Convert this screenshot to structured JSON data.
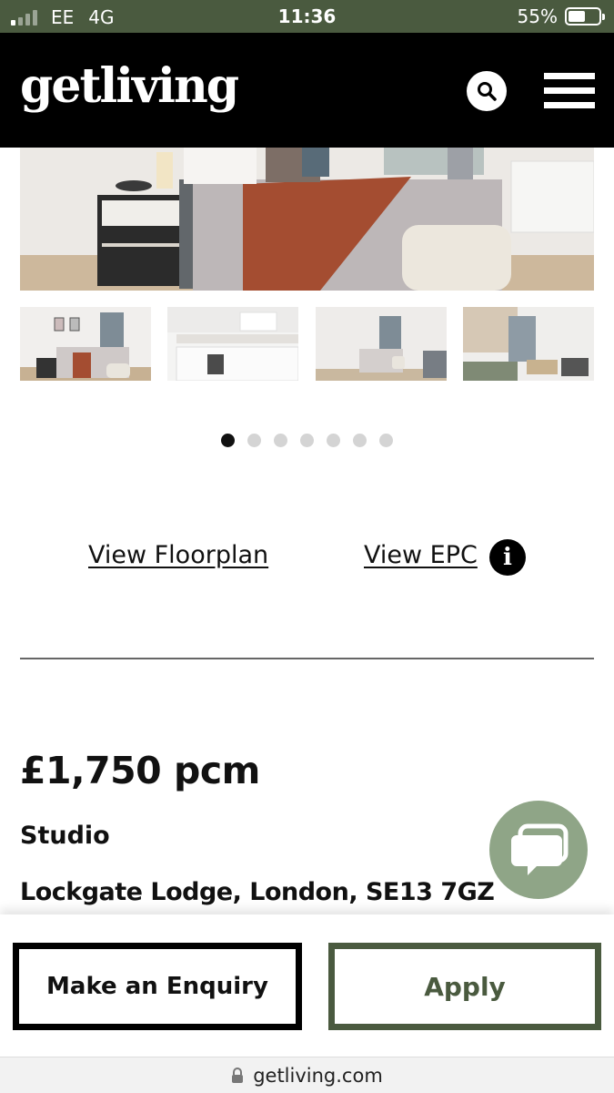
{
  "status_bar": {
    "carrier": "EE",
    "network": "4G",
    "time": "11:36",
    "battery_percent": "55%",
    "battery_level": 0.55,
    "signal_bars_filled": 1,
    "signal_bars_total": 4
  },
  "header": {
    "logo": "getliving",
    "icons": [
      "search-icon",
      "hamburger-menu-icon"
    ],
    "background": "#000000",
    "accent": "#4a5a3f"
  },
  "gallery": {
    "hero_alt": "bedroom photo",
    "thumbnails": [
      "bedroom",
      "kitchen",
      "bedroom-wide",
      "living-room"
    ],
    "dots_total": 7,
    "active_dot": 1
  },
  "links": {
    "floorplan": "View Floorplan",
    "epc": "View EPC",
    "info_icon": "i"
  },
  "listing": {
    "price": "£1,750 pcm",
    "property_type": "Studio",
    "address": "Lockgate Lodge, London, SE13 7GZ"
  },
  "actions": {
    "enquiry": "Make an Enquiry",
    "apply": "Apply"
  },
  "chat": {
    "icon": "chat-bubble-icon",
    "color": "#8fa587"
  },
  "browser": {
    "url": "getliving.com"
  }
}
